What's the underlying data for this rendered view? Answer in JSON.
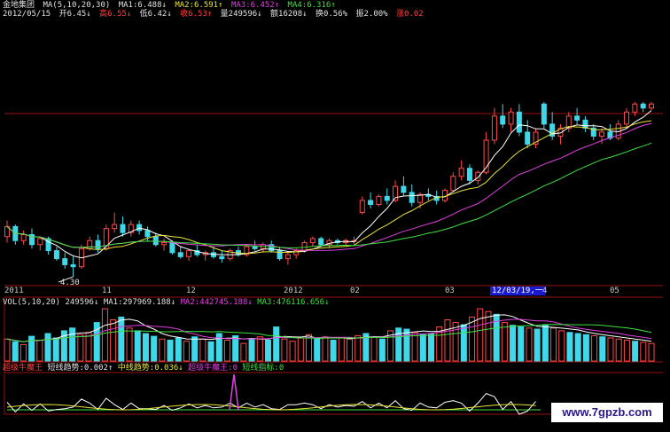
{
  "header": {
    "stock_name": "金地集团",
    "ma_label": "MA(5,10,20,30)",
    "ma1": "MA1:6.488↓",
    "ma2": "MA2:6.591↑",
    "ma3": "MA3:6.452↑",
    "ma4": "MA4:6.316↑",
    "date": "2012/05/15",
    "open": "开6.45↓",
    "high": "高6.55↓",
    "low": "低6.42↓",
    "close": "收6.53↑",
    "volume": "量249596↓",
    "amount": "额16208↓",
    "turnover": "换0.56%",
    "amplitude": "振2.00%",
    "change": "涨0.02"
  },
  "x_axis_ticks": [
    "2011",
    "11",
    "12",
    "2012",
    "02",
    "03",
    "12/03/19,一",
    "4",
    "05"
  ],
  "annotations": {
    "low_price": "4.30"
  },
  "volume_header": {
    "label": "VOL(5,10,20)",
    "value": "249596↓",
    "ma1": "MA1:297969.188↓",
    "ma2": "MA2:442745.188↓",
    "ma3": "MA3:476116.656↓"
  },
  "indicator_header": {
    "name": "超级牛魔王",
    "short": "短线趋势:0.002↑",
    "mid": "中线趋势:0.036↓",
    "king": "超级牛魔王:0",
    "index": "短线指标:0"
  },
  "watermark": "www.7gpzb.com",
  "colors": {
    "up": "#ff4a4a",
    "down": "#40d8e8",
    "ma1": "#ffffff",
    "ma2": "#e8e23a",
    "ma3": "#e040e0",
    "ma4": "#40e040",
    "grid": "#9a1010"
  },
  "chart_data": [
    {
      "type": "candlestick",
      "title": "金地集团",
      "price_series": [
        [
          5.3,
          5.7,
          5.15,
          5.55
        ],
        [
          5.55,
          5.6,
          5.1,
          5.2
        ],
        [
          5.2,
          5.45,
          5.1,
          5.35
        ],
        [
          5.35,
          5.5,
          5.0,
          5.1
        ],
        [
          5.1,
          5.3,
          4.95,
          5.25
        ],
        [
          5.25,
          5.3,
          4.85,
          4.95
        ],
        [
          4.95,
          5.05,
          4.7,
          4.75
        ],
        [
          4.75,
          4.9,
          4.5,
          4.6
        ],
        [
          4.6,
          4.8,
          4.3,
          4.55
        ],
        [
          4.55,
          5.1,
          4.5,
          5.0
        ],
        [
          5.0,
          5.3,
          4.95,
          5.2
        ],
        [
          5.2,
          5.35,
          4.9,
          5.0
        ],
        [
          5.0,
          5.6,
          4.95,
          5.5
        ],
        [
          5.5,
          5.9,
          5.4,
          5.6
        ],
        [
          5.6,
          5.8,
          5.3,
          5.4
        ],
        [
          5.4,
          5.7,
          5.3,
          5.6
        ],
        [
          5.6,
          5.7,
          5.35,
          5.45
        ],
        [
          5.45,
          5.55,
          5.2,
          5.3
        ],
        [
          5.3,
          5.4,
          5.05,
          5.1
        ],
        [
          5.1,
          5.25,
          4.95,
          5.15
        ],
        [
          5.15,
          5.2,
          4.85,
          4.9
        ],
        [
          4.9,
          5.05,
          4.75,
          4.8
        ],
        [
          4.8,
          5.0,
          4.7,
          4.95
        ],
        [
          4.95,
          5.1,
          4.8,
          4.85
        ],
        [
          4.85,
          4.95,
          4.7,
          4.9
        ],
        [
          4.9,
          5.05,
          4.75,
          4.8
        ],
        [
          4.8,
          4.95,
          4.65,
          4.75
        ],
        [
          4.75,
          5.0,
          4.7,
          4.95
        ],
        [
          4.95,
          5.05,
          4.8,
          4.85
        ],
        [
          4.85,
          5.1,
          4.8,
          5.05
        ],
        [
          5.05,
          5.2,
          4.95,
          5.0
        ],
        [
          5.0,
          5.15,
          4.9,
          5.1
        ],
        [
          5.1,
          5.2,
          4.9,
          4.95
        ],
        [
          4.95,
          5.05,
          4.7,
          4.75
        ],
        [
          4.75,
          4.9,
          4.6,
          4.85
        ],
        [
          4.85,
          5.0,
          4.75,
          4.95
        ],
        [
          4.95,
          5.2,
          4.9,
          5.15
        ],
        [
          5.15,
          5.3,
          5.05,
          5.25
        ],
        [
          5.25,
          5.3,
          5.05,
          5.1
        ],
        [
          5.1,
          5.25,
          5.0,
          5.2
        ],
        [
          5.2,
          5.25,
          5.1,
          5.15
        ],
        [
          5.15,
          5.25,
          5.05,
          5.2
        ],
        [
          5.2,
          5.3,
          5.1,
          5.2
        ],
        [
          5.9,
          6.3,
          5.85,
          6.2
        ],
        [
          6.2,
          6.4,
          6.0,
          6.1
        ],
        [
          6.1,
          6.35,
          6.05,
          6.3
        ],
        [
          6.3,
          6.5,
          6.1,
          6.2
        ],
        [
          6.2,
          6.7,
          6.15,
          6.55
        ],
        [
          6.55,
          6.8,
          6.3,
          6.4
        ],
        [
          6.4,
          6.6,
          6.05,
          6.15
        ],
        [
          6.15,
          6.4,
          6.0,
          6.35
        ],
        [
          6.35,
          6.5,
          6.2,
          6.3
        ],
        [
          6.3,
          6.45,
          6.1,
          6.2
        ],
        [
          6.2,
          6.5,
          6.15,
          6.45
        ],
        [
          6.45,
          6.9,
          6.4,
          6.8
        ],
        [
          6.8,
          7.2,
          6.7,
          7.0
        ],
        [
          7.0,
          7.1,
          6.6,
          6.7
        ],
        [
          6.7,
          6.95,
          6.6,
          6.9
        ],
        [
          6.9,
          7.9,
          6.85,
          7.7
        ],
        [
          7.7,
          8.5,
          7.6,
          8.3
        ],
        [
          8.3,
          8.6,
          8.0,
          8.1
        ],
        [
          8.1,
          8.5,
          7.9,
          8.4
        ],
        [
          8.4,
          8.6,
          7.8,
          7.9
        ],
        [
          7.9,
          8.2,
          7.5,
          7.6
        ],
        [
          7.6,
          8.0,
          7.5,
          7.9
        ],
        [
          8.6,
          8.65,
          8.0,
          8.1
        ],
        [
          8.1,
          8.4,
          7.7,
          7.8
        ],
        [
          7.8,
          8.1,
          7.6,
          8.0
        ],
        [
          8.0,
          8.4,
          7.9,
          8.3
        ],
        [
          8.3,
          8.5,
          8.1,
          8.2
        ],
        [
          8.2,
          8.3,
          7.9,
          8.0
        ],
        [
          8.0,
          8.1,
          7.7,
          7.8
        ],
        [
          7.8,
          8.0,
          7.6,
          7.9
        ],
        [
          7.9,
          8.1,
          7.7,
          7.75
        ],
        [
          7.75,
          8.2,
          7.7,
          8.1
        ],
        [
          8.1,
          8.5,
          8.0,
          8.4
        ],
        [
          8.4,
          8.65,
          8.3,
          8.6
        ],
        [
          8.6,
          8.65,
          8.4,
          8.5
        ],
        [
          8.5,
          8.65,
          8.45,
          8.6
        ]
      ],
      "moving_averages": [
        "MA1",
        "MA2",
        "MA3",
        "MA4"
      ]
    },
    {
      "type": "bar",
      "title": "VOL(5,10,20)",
      "values": [
        40,
        35,
        30,
        45,
        38,
        50,
        42,
        55,
        60,
        48,
        52,
        70,
        95,
        75,
        80,
        60,
        55,
        50,
        45,
        40,
        38,
        42,
        36,
        44,
        40,
        35,
        50,
        38,
        46,
        32,
        40,
        44,
        38,
        62,
        40,
        36,
        42,
        48,
        40,
        44,
        38,
        42,
        40,
        46,
        50,
        44,
        40,
        55,
        60,
        58,
        52,
        48,
        50,
        62,
        75,
        70,
        66,
        80,
        95,
        90,
        85,
        70,
        65,
        62,
        60,
        58,
        66,
        60,
        55,
        52,
        50,
        48,
        46,
        44,
        42,
        40,
        38,
        36,
        34,
        32
      ]
    }
  ]
}
